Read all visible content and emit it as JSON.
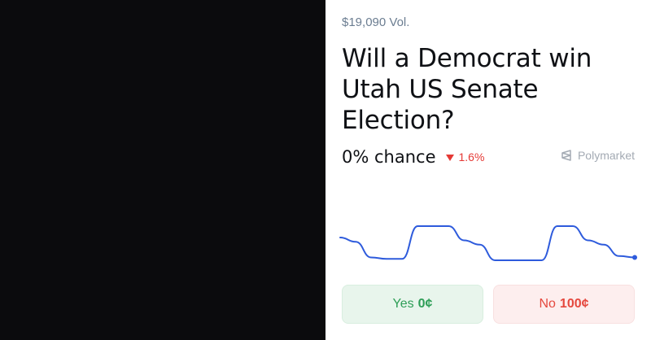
{
  "market": {
    "volume": "$19,090 Vol.",
    "question": "Will a Democrat win Utah US Senate Election?",
    "chance": "0% chance",
    "change": "1.6%",
    "change_direction": "down",
    "brand": "Polymarket"
  },
  "buttons": {
    "yes_label": "Yes",
    "yes_value": "0¢",
    "no_label": "No",
    "no_value": "100¢"
  },
  "colors": {
    "line": "#2e5bdc",
    "down": "#e53935",
    "yes": "#2e9e57",
    "no": "#e5483e"
  },
  "chart_data": {
    "type": "line",
    "series": [
      {
        "values": [
          1.8,
          1.5,
          0.4,
          0.3,
          0.3,
          2.6,
          2.6,
          2.6,
          1.6,
          1.3,
          0.2,
          0.2,
          0.2,
          0.2,
          2.6,
          2.6,
          1.6,
          1.3,
          0.5,
          0.4
        ]
      }
    ],
    "grid": false,
    "axes": false
  }
}
